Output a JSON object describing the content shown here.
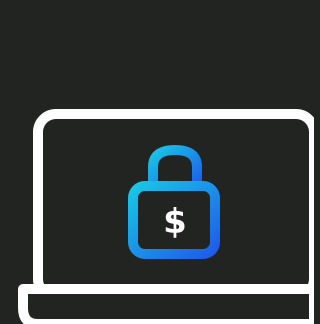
{
  "illustration": {
    "icon": "laptop-with-padlock-dollar",
    "padlock_symbol": "$",
    "colors": {
      "background": "#222422",
      "laptop_outline": "#FFFFFF",
      "screen_fill": "#222422",
      "padlock_gradient_start": "#19C6E6",
      "padlock_gradient_end": "#1E5BEA",
      "padlock_symbol": "#FFFFFF"
    }
  }
}
